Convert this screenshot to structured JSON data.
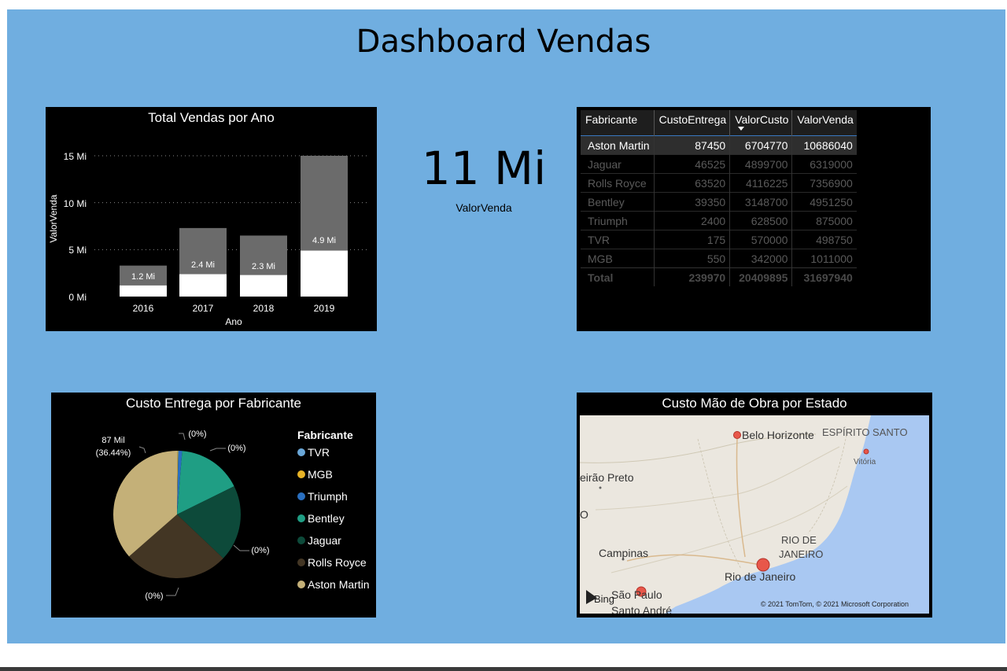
{
  "dashboard": {
    "title": "Dashboard Vendas"
  },
  "bar_chart": {
    "title": "Total Vendas por Ano",
    "xlabel": "Ano",
    "ylabel": "ValorVenda",
    "ticks": [
      "0 Mi",
      "5 Mi",
      "10 Mi",
      "15 Mi"
    ],
    "data_labels": [
      "1.2 Mi",
      "2.4 Mi",
      "2.3 Mi",
      "4.9 Mi"
    ]
  },
  "chart_data": [
    {
      "type": "bar",
      "title": "Total Vendas por Ano",
      "xlabel": "Ano",
      "ylabel": "ValorVenda",
      "categories": [
        "2016",
        "2017",
        "2018",
        "2019"
      ],
      "series": [
        {
          "values": [
            1.2,
            2.4,
            2.3,
            4.9
          ]
        },
        {
          "values": [
            2.1,
            4.9,
            4.2,
            10.1
          ]
        }
      ],
      "ylim": [
        0,
        15
      ],
      "stacked": true,
      "grid": true,
      "colors": [
        "#ffffff",
        "#6b6b6b"
      ]
    },
    {
      "type": "pie",
      "title": "Custo Entrega por Fabricante",
      "categories": [
        "TVR",
        "MGB",
        "Triumph",
        "Bentley",
        "Jaguar",
        "Rolls Royce",
        "Aston Martin"
      ],
      "values": [
        175,
        550,
        2400,
        39350,
        46525,
        63520,
        87450
      ],
      "colors": [
        "#6aa7d8",
        "#e8b326",
        "#2a6fc0",
        "#1f9e84",
        "#0d4a3a",
        "#433624",
        "#c4b078"
      ],
      "legend_title": "Fabricante",
      "legend_position": "right"
    }
  ],
  "kpi": {
    "value": "11 Mi",
    "label": "ValorVenda"
  },
  "table": {
    "columns": [
      "Fabricante",
      "CustoEntrega",
      "ValorCusto",
      "ValorVenda"
    ],
    "rows": [
      [
        "Aston Martin",
        "87450",
        "6704770",
        "10686040"
      ],
      [
        "Jaguar",
        "46525",
        "4899700",
        "6319000"
      ],
      [
        "Rolls Royce",
        "63520",
        "4116225",
        "7356900"
      ],
      [
        "Bentley",
        "39350",
        "3148700",
        "4951250"
      ],
      [
        "Triumph",
        "2400",
        "628500",
        "875000"
      ],
      [
        "TVR",
        "175",
        "570000",
        "498750"
      ],
      [
        "MGB",
        "550",
        "342000",
        "1011000"
      ]
    ],
    "total": [
      "Total",
      "239970",
      "20409895",
      "31697940"
    ]
  },
  "pie_chart": {
    "title": "Custo Entrega por Fabricante",
    "labels": {
      "main_value": "87 Mil",
      "main_pct": "(36.44%)",
      "zero": "(0%)"
    }
  },
  "map": {
    "title": "Custo Mão de Obra por Estado",
    "places": {
      "belo_horizonte": "Belo Horizonte",
      "espirito_santo": "ESPÍRITO SANTO",
      "vitoria": "Vitória",
      "ribeirao_preto": "eirão Preto",
      "campinas": "Campinas",
      "rio_state_1": "RIO DE",
      "rio_state_2": "JANEIRO",
      "rio_city": "Rio de Janeiro",
      "sao_paulo": "São Paulo",
      "santo_andre": "Santo André",
      "o_fragment": "O"
    },
    "attribution": "© 2021 TomTom, © 2021 Microsoft Corporation",
    "bing": "Bing"
  }
}
